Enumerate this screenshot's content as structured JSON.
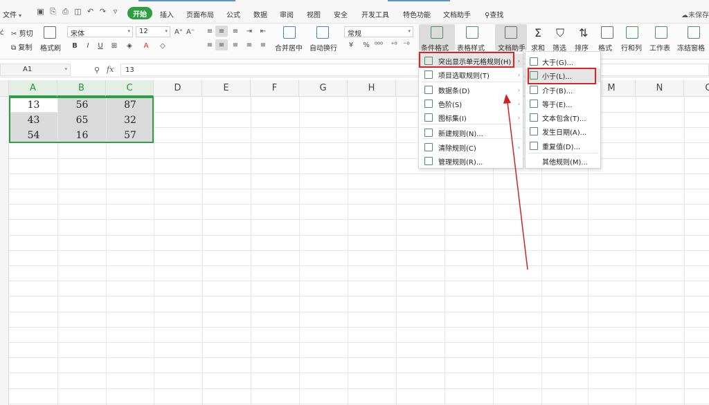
{
  "topbar": {
    "file_menu": "文件",
    "tabs": [
      "插入",
      "页面布局",
      "公式",
      "数据",
      "审阅",
      "视图",
      "安全",
      "开发工具",
      "特色功能",
      "文档助手"
    ],
    "start_tab": "开始",
    "search": "查找",
    "unsaved": "未保存"
  },
  "ribbon": {
    "cut": "剪切",
    "copy": "复制",
    "format_painter": "格式刷",
    "font_name": "宋体",
    "font_size": "12",
    "merge_center": "合并居中",
    "wrap_text": "自动换行",
    "number_format": "常规",
    "conditional_format": "条件格式",
    "table_style": "表格样式",
    "doc_assistant": "文档助手",
    "sum": "求和",
    "filter": "筛选",
    "sort": "排序",
    "format": "格式",
    "row_col": "行和列",
    "worksheet": "工作表",
    "freeze": "冻结窗格",
    "bold": "B",
    "italic": "I",
    "underline": "U"
  },
  "formula_bar": {
    "cell_ref": "A1",
    "fx": "fx",
    "value": "13"
  },
  "columns": [
    "A",
    "B",
    "C",
    "D",
    "E",
    "F",
    "G",
    "H",
    "",
    "",
    "",
    "",
    "M",
    "N",
    "O"
  ],
  "cells": [
    [
      "13",
      "56",
      "87"
    ],
    [
      "43",
      "65",
      "32"
    ],
    [
      "54",
      "16",
      "57"
    ]
  ],
  "menu_main": {
    "items": [
      {
        "label": "突出显示单元格规则(H)",
        "has_sub": true
      },
      {
        "label": "项目选取规则(T)",
        "has_sub": true
      },
      {
        "label": "数据条(D)",
        "has_sub": true
      },
      {
        "label": "色阶(S)",
        "has_sub": true
      },
      {
        "label": "图标集(I)",
        "has_sub": true
      },
      {
        "label": "新建规则(N)...",
        "has_sub": false
      },
      {
        "label": "清除规则(C)",
        "has_sub": true
      },
      {
        "label": "管理规则(R)...",
        "has_sub": false
      }
    ]
  },
  "menu_sub": {
    "items": [
      {
        "label": "大于(G)..."
      },
      {
        "label": "小于(L)..."
      },
      {
        "label": "介于(B)..."
      },
      {
        "label": "等于(E)..."
      },
      {
        "label": "文本包含(T)..."
      },
      {
        "label": "发生日期(A)..."
      },
      {
        "label": "重复值(D)..."
      },
      {
        "label": "其他规则(M)..."
      }
    ]
  },
  "colors": {
    "accent_green": "#2e9e44",
    "highlight_red": "#e02020",
    "cell_shade": "#dadada"
  }
}
